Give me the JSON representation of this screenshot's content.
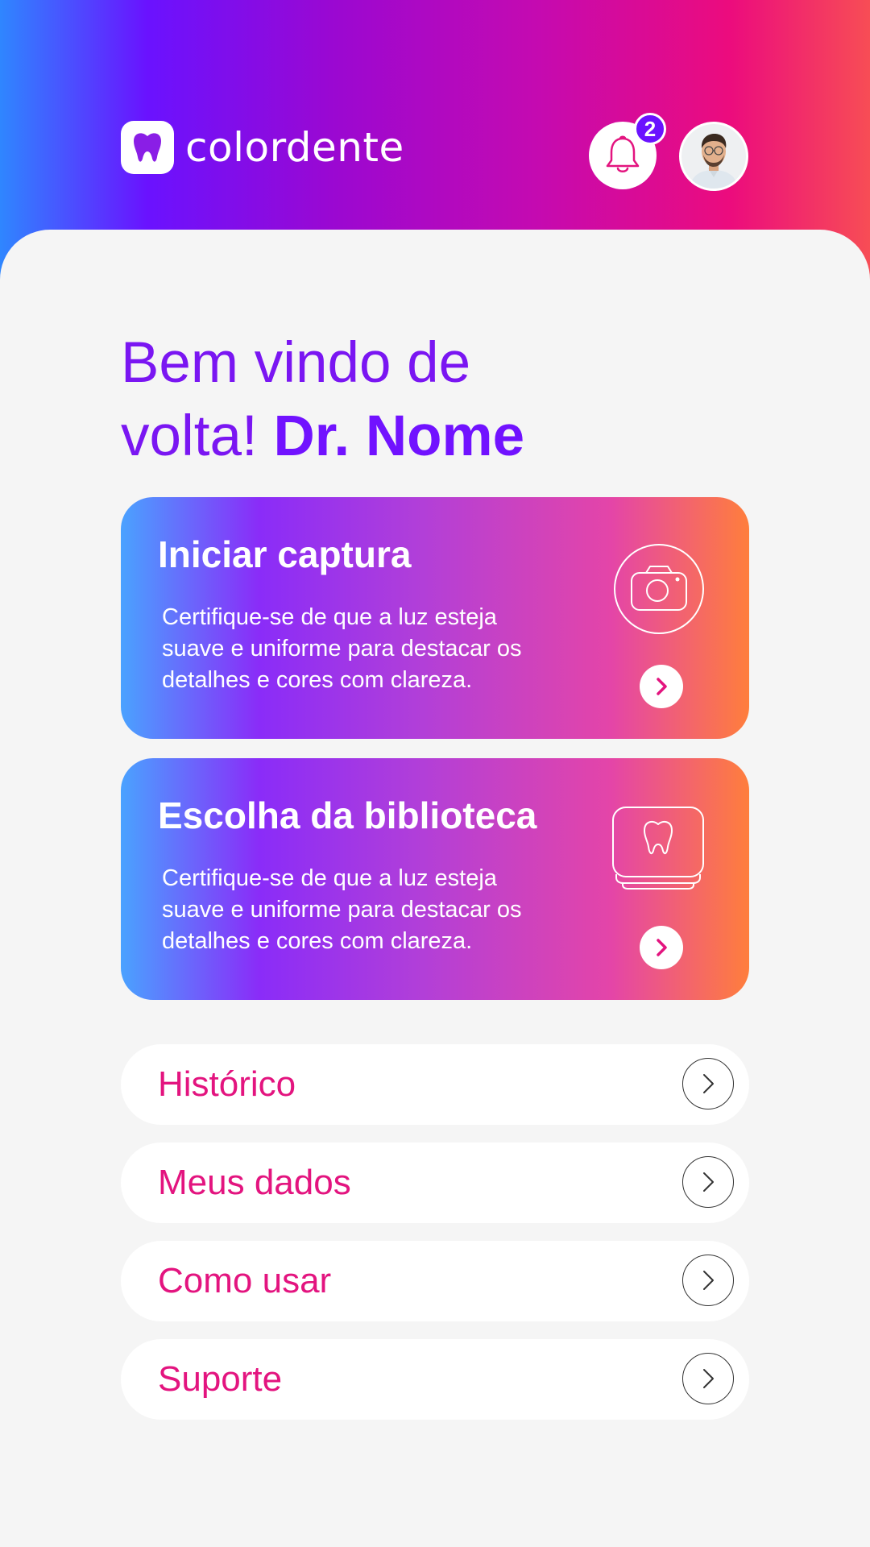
{
  "app": {
    "name": "colordente"
  },
  "header": {
    "notification_count": "2"
  },
  "welcome": {
    "line1": "Bem vindo de",
    "line2_prefix": "volta!",
    "user_name": "Dr. Nome"
  },
  "cards": [
    {
      "title": "Iniciar captura",
      "description": "Certifique-se de que a luz esteja suave e uniforme para destacar os detalhes e cores com clareza.",
      "icon": "camera-icon"
    },
    {
      "title": "Escolha da biblioteca",
      "description": "Certifique-se de que a luz esteja suave e uniforme para destacar os detalhes e cores com clareza.",
      "icon": "tooth-library-icon"
    }
  ],
  "menu": [
    {
      "label": "Histórico"
    },
    {
      "label": "Meus dados"
    },
    {
      "label": "Como usar"
    },
    {
      "label": "Suporte"
    }
  ],
  "colors": {
    "accent": "#7112ff",
    "pink": "#e3147f"
  }
}
